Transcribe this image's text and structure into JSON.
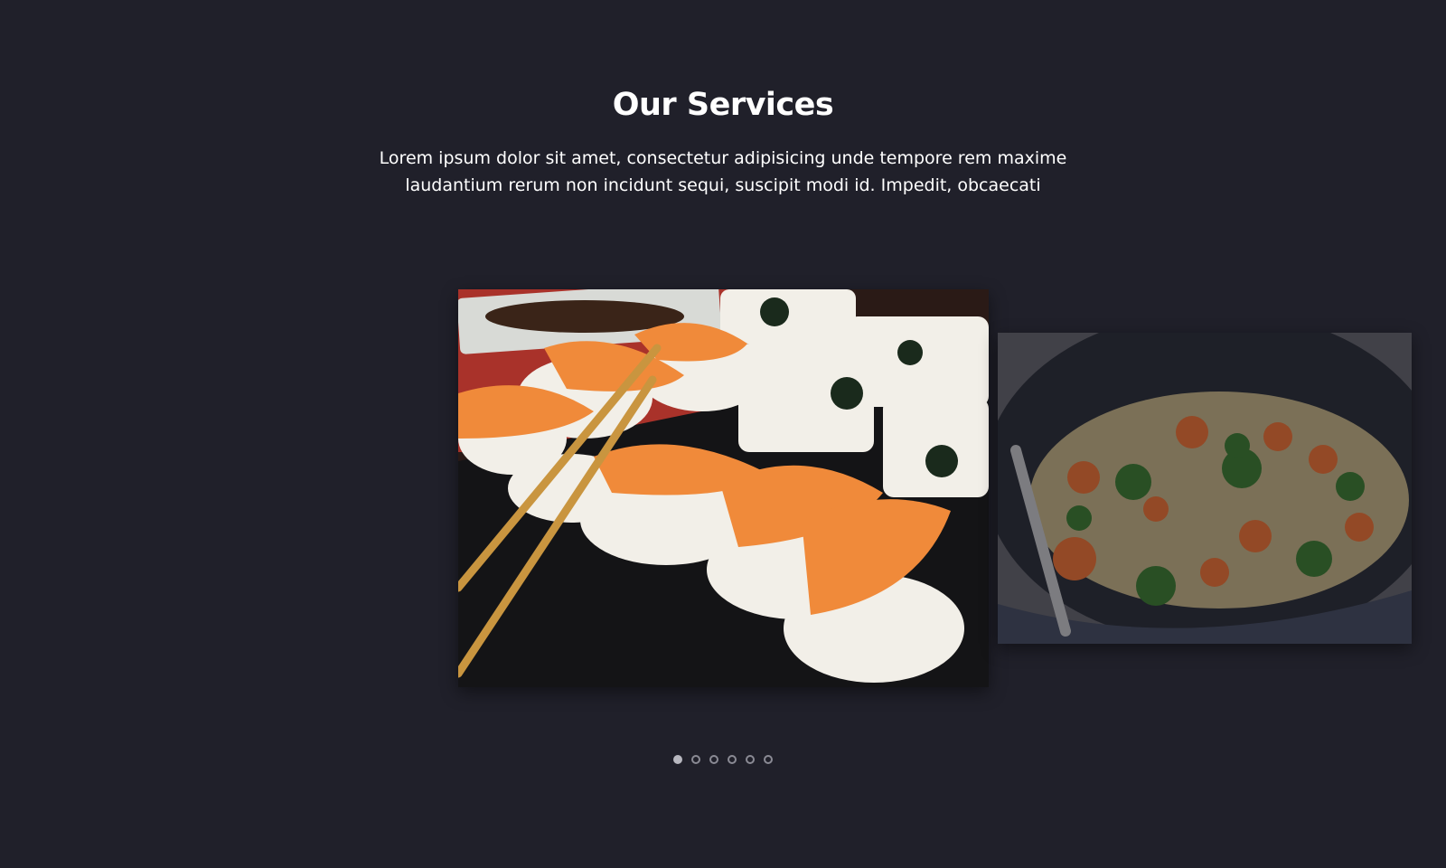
{
  "services": {
    "title": "Our Services",
    "description": "Lorem ipsum dolor sit amet, consectetur adipisicing unde tempore rem maxime laudantium rerum non incidunt sequi, suscipit modi id. Impedit, obcaecati"
  },
  "carousel": {
    "slides": [
      {
        "image": "sushi-platter-photo",
        "active": true
      },
      {
        "image": "fried-rice-pan-photo",
        "active": false
      }
    ],
    "dot_count": 6,
    "active_dot": 1
  },
  "colors": {
    "background": "#20202a",
    "text": "#ffffff",
    "dot_inactive": "#8a8a94",
    "dot_active": "#b8b8c0"
  }
}
